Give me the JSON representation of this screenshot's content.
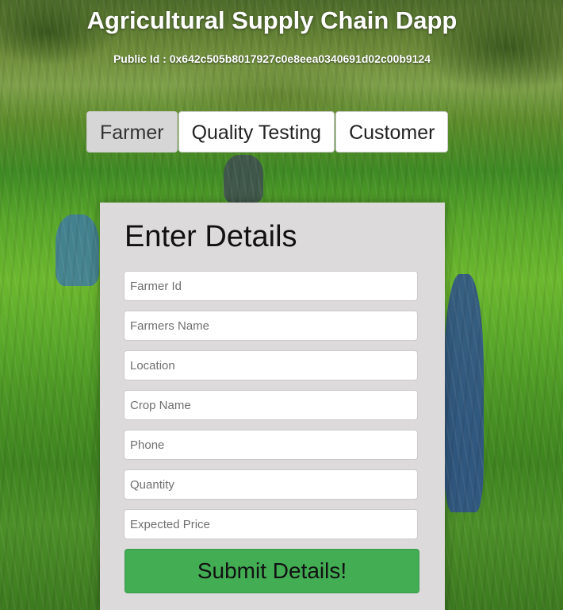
{
  "header": {
    "title": "Agricultural Supply Chain Dapp",
    "public_id": "Public Id : 0x642c505b8017927c0e8eea0340691d02c00b9124"
  },
  "tabs": [
    {
      "label": "Farmer",
      "active": true
    },
    {
      "label": "Quality Testing",
      "active": false
    },
    {
      "label": "Customer",
      "active": false
    }
  ],
  "form": {
    "heading": "Enter Details",
    "fields": [
      {
        "placeholder": "Farmer Id",
        "value": ""
      },
      {
        "placeholder": "Farmers Name",
        "value": ""
      },
      {
        "placeholder": "Location",
        "value": ""
      },
      {
        "placeholder": "Crop Name",
        "value": ""
      },
      {
        "placeholder": "Phone",
        "value": ""
      },
      {
        "placeholder": "Quantity",
        "value": ""
      },
      {
        "placeholder": "Expected Price",
        "value": ""
      }
    ],
    "submit_label": "Submit Details!"
  },
  "colors": {
    "submit_bg": "#43ad54",
    "panel_bg": "#dcdadb",
    "active_tab_bg": "#d6d6d6"
  }
}
